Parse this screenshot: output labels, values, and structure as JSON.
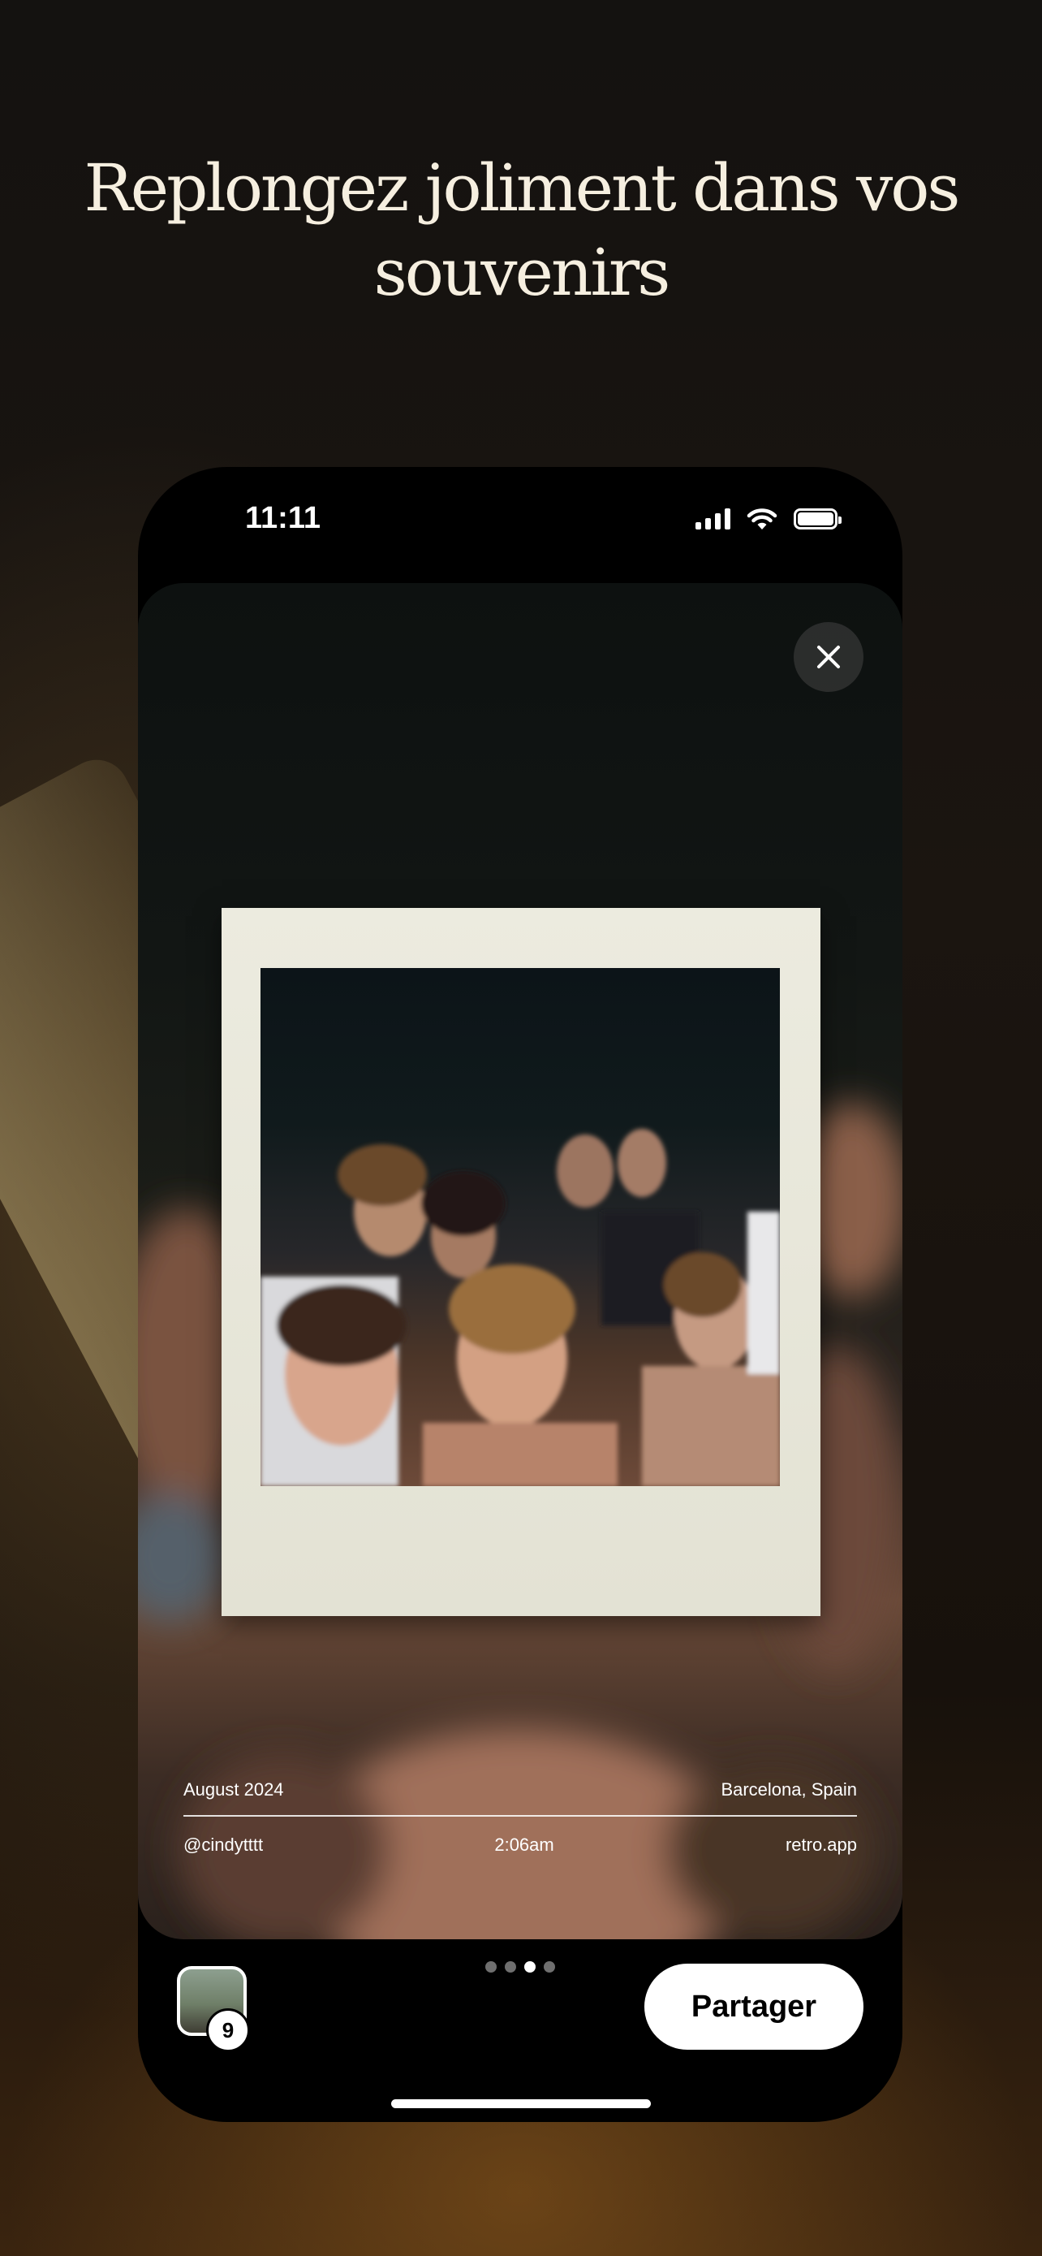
{
  "headline": "Replongez joliment dans vos souvenirs",
  "status": {
    "time": "11:11"
  },
  "photo_meta": {
    "date": "August 2024",
    "location": "Barcelona, Spain",
    "user": "@cindytttt",
    "time": "2:06am",
    "site": "retro.app"
  },
  "bottom": {
    "thumb_count": "9",
    "share_label": "Partager",
    "pager": {
      "total": 4,
      "active_index": 2
    }
  },
  "icons": {
    "close": "close-icon",
    "signal": "cellular-signal-icon",
    "wifi": "wifi-icon",
    "battery": "battery-icon"
  }
}
